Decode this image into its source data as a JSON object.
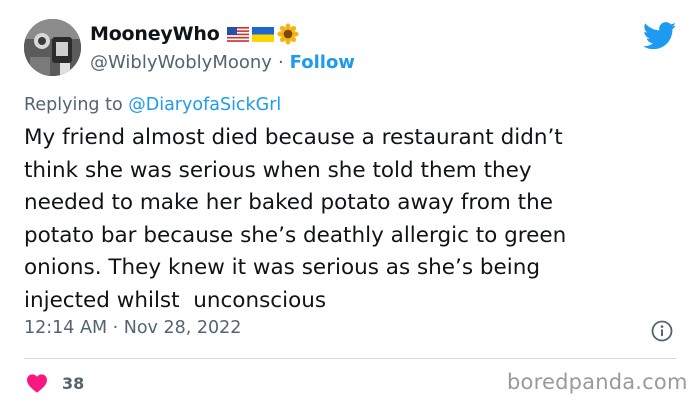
{
  "author": {
    "display_name": "MooneyWho",
    "handle": "@WiblyWoblyMoony",
    "separator": "·",
    "follow_label": "Follow",
    "flags": [
      "us-flag-icon",
      "ukraine-flag-icon",
      "sunflower-icon"
    ]
  },
  "reply": {
    "prefix": "Replying to",
    "mention": "@DiaryofaSickGrl"
  },
  "tweet": {
    "text": "My friend almost died because a restaurant didn’t\nthink she was serious when she told them they\nneeded to make her baked potato away from the\npotato bar because she’s deathly allergic to green\nonions. They knew it was serious as she’s being\ninjected whilst  unconscious"
  },
  "meta": {
    "timestamp": "12:14 AM · Nov 28, 2022"
  },
  "engagement": {
    "likes": "38"
  },
  "watermark": "boredpanda.com",
  "colors": {
    "accent": "#1d9bf0",
    "like": "#f91880",
    "text": "#0f1419",
    "secondary": "#536471"
  }
}
